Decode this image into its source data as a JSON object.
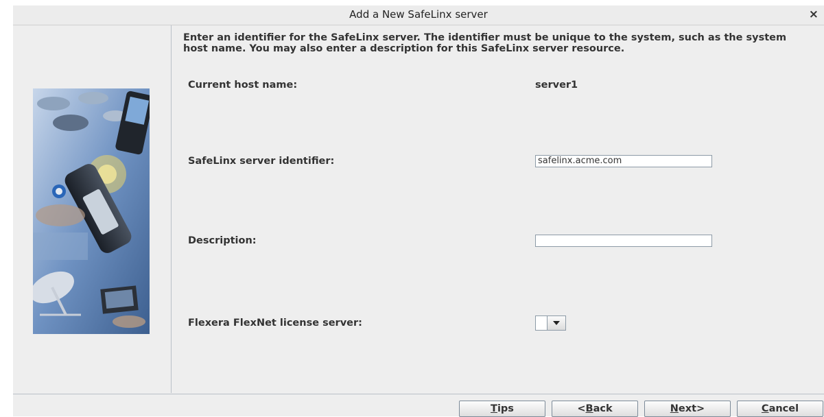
{
  "window": {
    "title": "Add a New SafeLinx server",
    "close_glyph": "×"
  },
  "intro_text": "Enter an identifier for the SafeLinx server.  The identifier must be unique to the system, such as the system host name. You may also enter a description for this SafeLinx server resource.",
  "form": {
    "host_label": "Current host name:",
    "host_value": "server1",
    "identifier_label": "SafeLinx server identifier:",
    "identifier_value": "safelinx.acme.com",
    "description_label": "Description:",
    "description_value": "",
    "license_label": "Flexera FlexNet license server:",
    "license_value": ""
  },
  "buttons": {
    "tips": {
      "mnemonic": "T",
      "rest": "ips"
    },
    "back": {
      "pre": "<",
      "mnemonic": "B",
      "rest": "ack"
    },
    "next": {
      "mnemonic": "N",
      "rest": "ext>"
    },
    "cancel": {
      "mnemonic": "C",
      "rest": "ancel"
    }
  },
  "icons": {
    "close": "close-icon",
    "dropdown": "chevron-down-icon"
  },
  "colors": {
    "dialog_bg": "#eeeeee",
    "border": "#b9c0c8",
    "banner_blue": "#5a7fb0"
  }
}
